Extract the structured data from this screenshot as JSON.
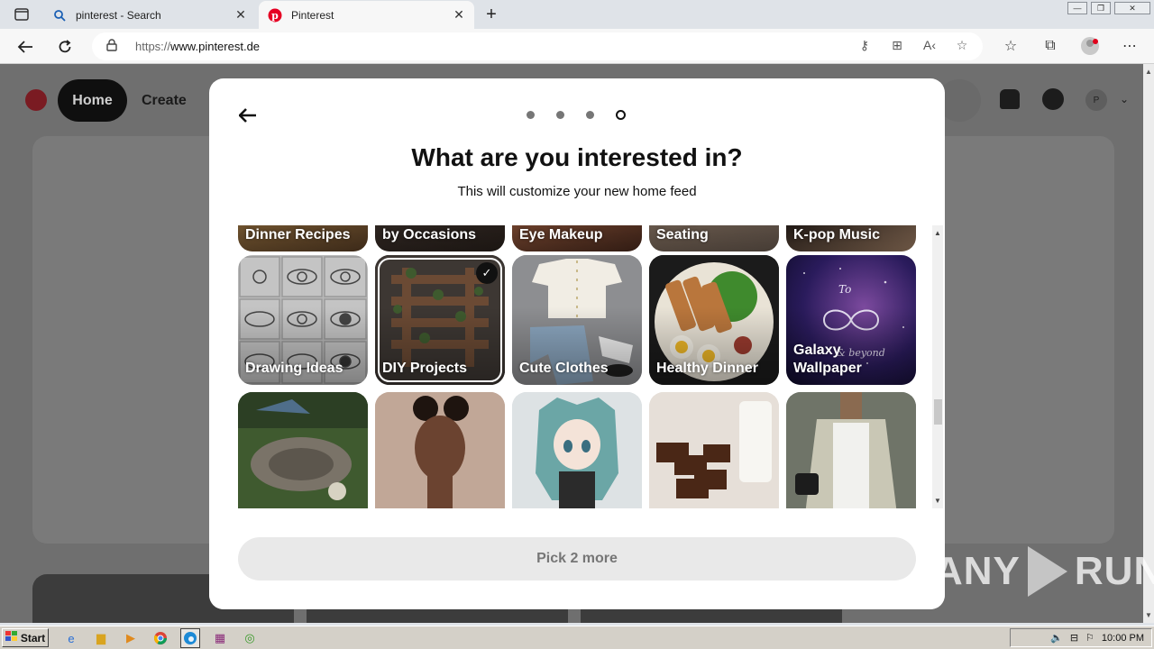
{
  "browser": {
    "tabs": [
      {
        "title": "pinterest - Search",
        "icon": "search-icon"
      },
      {
        "title": "Pinterest",
        "icon": "pinterest-icon",
        "active": true
      }
    ],
    "url_protocol": "https://",
    "url_host": "www.pinterest.de"
  },
  "background_page": {
    "home_label": "Home",
    "create_label": "Create",
    "avatar_initial": "P"
  },
  "modal": {
    "title": "What are you interested in?",
    "subtitle": "This will customize your new home feed",
    "steps_total": 4,
    "current_step": 4,
    "rows": [
      [
        {
          "label": "Dinner Recipes"
        },
        {
          "label": "Women's Outfits by Occasions"
        },
        {
          "label": "Eye Makeup"
        },
        {
          "label": "Living Room Seating"
        },
        {
          "label": "K-pop Music"
        }
      ],
      [
        {
          "label": "Drawing Ideas"
        },
        {
          "label": "DIY Projects",
          "selected": true
        },
        {
          "label": "Cute Clothes"
        },
        {
          "label": "Healthy Dinner"
        },
        {
          "label": "Galaxy Wallpaper"
        }
      ],
      [
        {
          "label": ""
        },
        {
          "label": ""
        },
        {
          "label": ""
        },
        {
          "label": ""
        },
        {
          "label": ""
        }
      ]
    ],
    "pick_button": "Pick 2 more"
  },
  "watermark": {
    "text_left": "ANY",
    "text_right": "RUN"
  },
  "taskbar": {
    "start_label": "Start",
    "clock": "10:00 PM"
  },
  "colors": {
    "pinterest_red": "#e60023",
    "overlay_bg": "#6f6f6f",
    "selected_outline": "#111111"
  }
}
